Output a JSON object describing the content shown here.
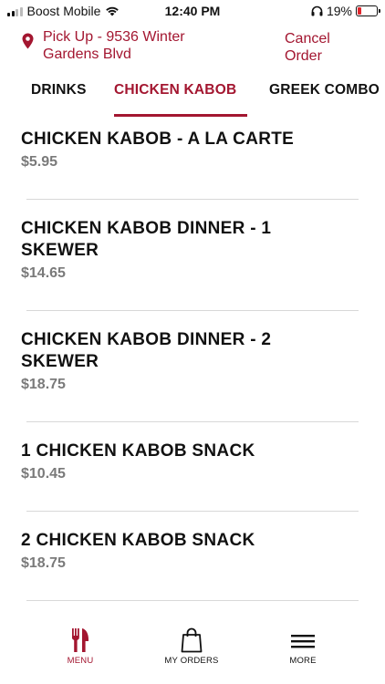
{
  "status_bar": {
    "carrier": "Boost Mobile",
    "time": "12:40 PM",
    "battery_percent": "19%",
    "battery_level": 0.19,
    "battery_color": "#e0262c"
  },
  "header": {
    "pickup_label": "Pick Up - 9536 Winter Gardens Blvd",
    "cancel_label": "Cancel Order",
    "accent_color": "#a31630"
  },
  "tabs": [
    {
      "label": "DRINKS",
      "active": false
    },
    {
      "label": "CHICKEN KABOB",
      "active": true
    },
    {
      "label": "GREEK COMBO",
      "active": false
    }
  ],
  "menu_items": [
    {
      "name": "CHICKEN KABOB - A LA CARTE",
      "price": "$5.95"
    },
    {
      "name": "CHICKEN KABOB DINNER - 1 SKEWER",
      "price": "$14.65"
    },
    {
      "name": "CHICKEN KABOB DINNER - 2 SKEWER",
      "price": "$18.75"
    },
    {
      "name": "1 CHICKEN KABOB SNACK",
      "price": "$10.45"
    },
    {
      "name": "2 CHICKEN KABOB SNACK",
      "price": "$18.75"
    }
  ],
  "bottom_nav": {
    "menu": {
      "label": "MENU",
      "icon": "fork-knife-icon",
      "active": true
    },
    "orders": {
      "label": "MY ORDERS",
      "icon": "shopping-bag-icon"
    },
    "more": {
      "label": "MORE",
      "icon": "hamburger-icon"
    }
  }
}
